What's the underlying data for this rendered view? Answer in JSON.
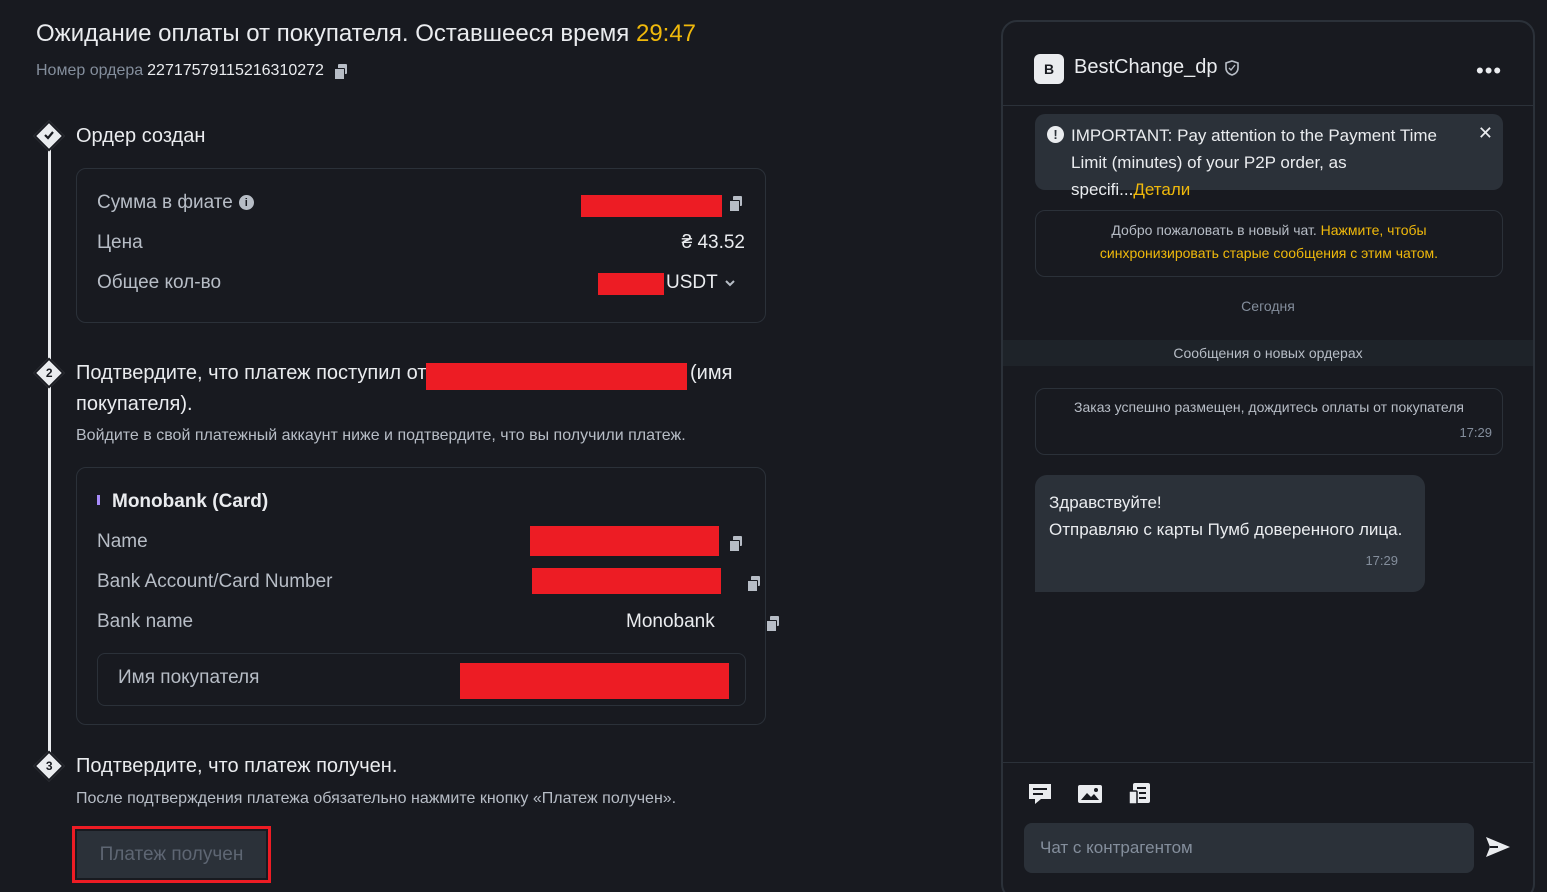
{
  "header": {
    "title": "Ожидание оплаты от покупателя. Оставшееся время",
    "timer": "29:47",
    "order_label": "Номер ордера",
    "order_number": "22717579115216310272"
  },
  "step1": {
    "number": "",
    "title": "Ордер создан",
    "fiat_label": "Сумма в фиате",
    "price_label": "Цена",
    "price_value": "₴ 43.52",
    "qty_label": "Общее кол-во",
    "qty_unit": "USDT"
  },
  "step2": {
    "number": "2",
    "title_before": "Подтвердите, что платеж поступил от",
    "title_after": "(имя",
    "title_line2": "покупателя).",
    "subtitle": "Войдите в свой платежный аккаунт ниже и подтвердите, что вы получили платеж.",
    "method": "Monobank (Card)",
    "name_label": "Name",
    "account_label": "Bank Account/Card Number",
    "bank_label": "Bank name",
    "bank_value": "Monobank",
    "buyer_label": "Имя покупателя"
  },
  "step3": {
    "number": "3",
    "title": "Подтвердите, что платеж получен.",
    "subtitle": "После подтверждения платежа обязательно нажмите кнопку «Платеж получен».",
    "button_label": "Платеж получен"
  },
  "chat": {
    "avatar_letter": "B",
    "name": "BestChange_dp",
    "more": "•••",
    "notice_text": "IMPORTANT: Pay attention to the Payment Time Limit (minutes) of your P2P order, as specifi...",
    "notice_link": "Детали",
    "notice_close": "✕",
    "welcome_text": "Добро пожаловать в новый чат.",
    "welcome_link": "Нажмите, чтобы синхронизировать старые сообщения с этим чатом.",
    "today": "Сегодня",
    "new_orders": "Сообщения о новых ордерах",
    "system_message": "Заказ успешно размещен, дождитесь оплаты от покупателя",
    "system_time": "17:29",
    "msg_line1": "Здравствуйте!",
    "msg_line2": "Отправляю с карты Пумб доверенного лица.",
    "msg_time": "17:29",
    "input_placeholder": "Чат с контрагентом"
  },
  "colors": {
    "accent": "#f0b90b",
    "background": "#181a20",
    "card_border": "#2b3139",
    "redaction": "#ed1c24"
  },
  "icons": [
    "copy-icon",
    "info-icon",
    "chevron-down-icon",
    "warning-icon",
    "close-icon",
    "shield-icon",
    "chat-icon",
    "image-icon",
    "order-icon",
    "send-icon"
  ]
}
